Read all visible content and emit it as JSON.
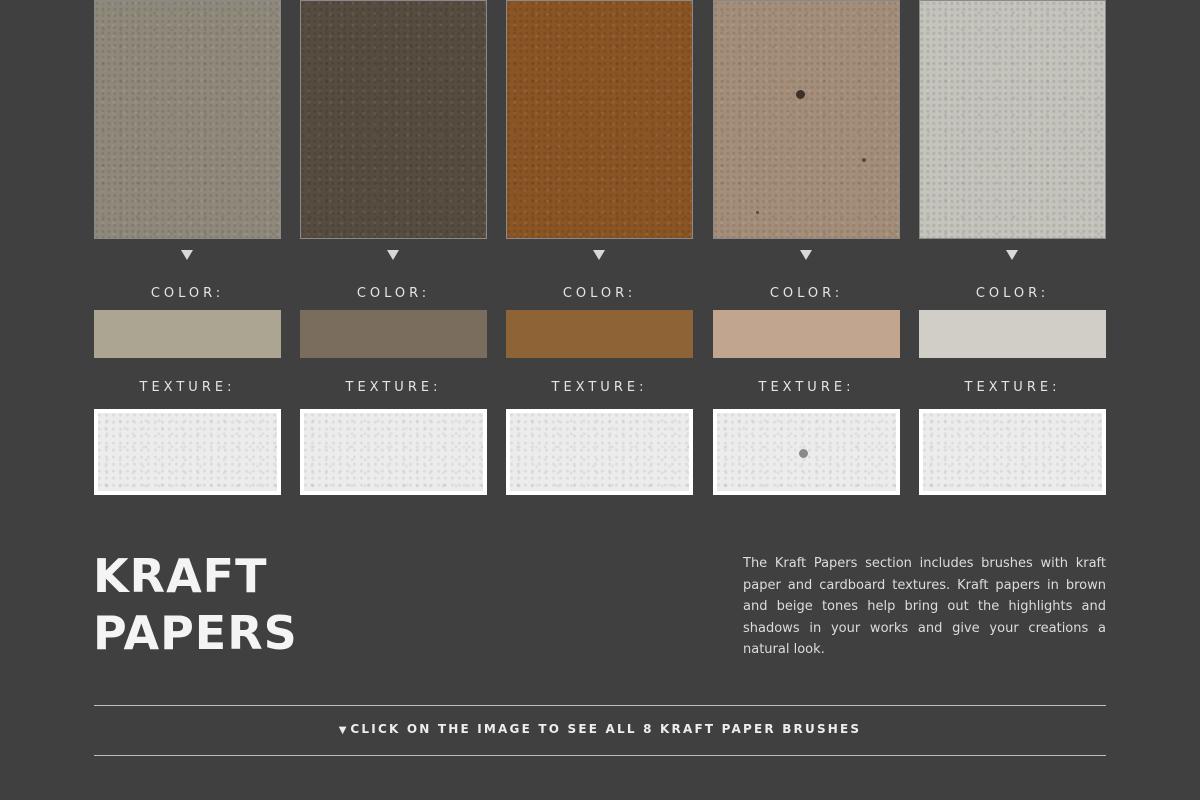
{
  "papers": [
    {
      "color_label": "COLOR:",
      "texture_label": "TEXTURE:",
      "paper_color": "#8f897b",
      "swatch_color": "#aca592"
    },
    {
      "color_label": "COLOR:",
      "texture_label": "TEXTURE:",
      "paper_color": "#564c40",
      "swatch_color": "#7b6d5e"
    },
    {
      "color_label": "COLOR:",
      "texture_label": "TEXTURE:",
      "paper_color": "#8a5424",
      "swatch_color": "#8e6437"
    },
    {
      "color_label": "COLOR:",
      "texture_label": "TEXTURE:",
      "paper_color": "#a48e7a",
      "swatch_color": "#c1a58f"
    },
    {
      "color_label": "COLOR:",
      "texture_label": "TEXTURE:",
      "paper_color": "#c4c3bc",
      "swatch_color": "#d0cec7"
    }
  ],
  "section": {
    "title_line1": "KRAFT",
    "title_line2": "PAPERS",
    "description": "The Kraft Papers section includes brushes with kraft paper and cardboard textures. Kraft papers in brown and beige tones help bring out the highlights and shadows in your works and give your creations a natural look."
  },
  "cta": {
    "arrow": "▼",
    "text": "CLICK ON THE IMAGE TO SEE ALL 8 KRAFT PAPER BRUSHES"
  }
}
